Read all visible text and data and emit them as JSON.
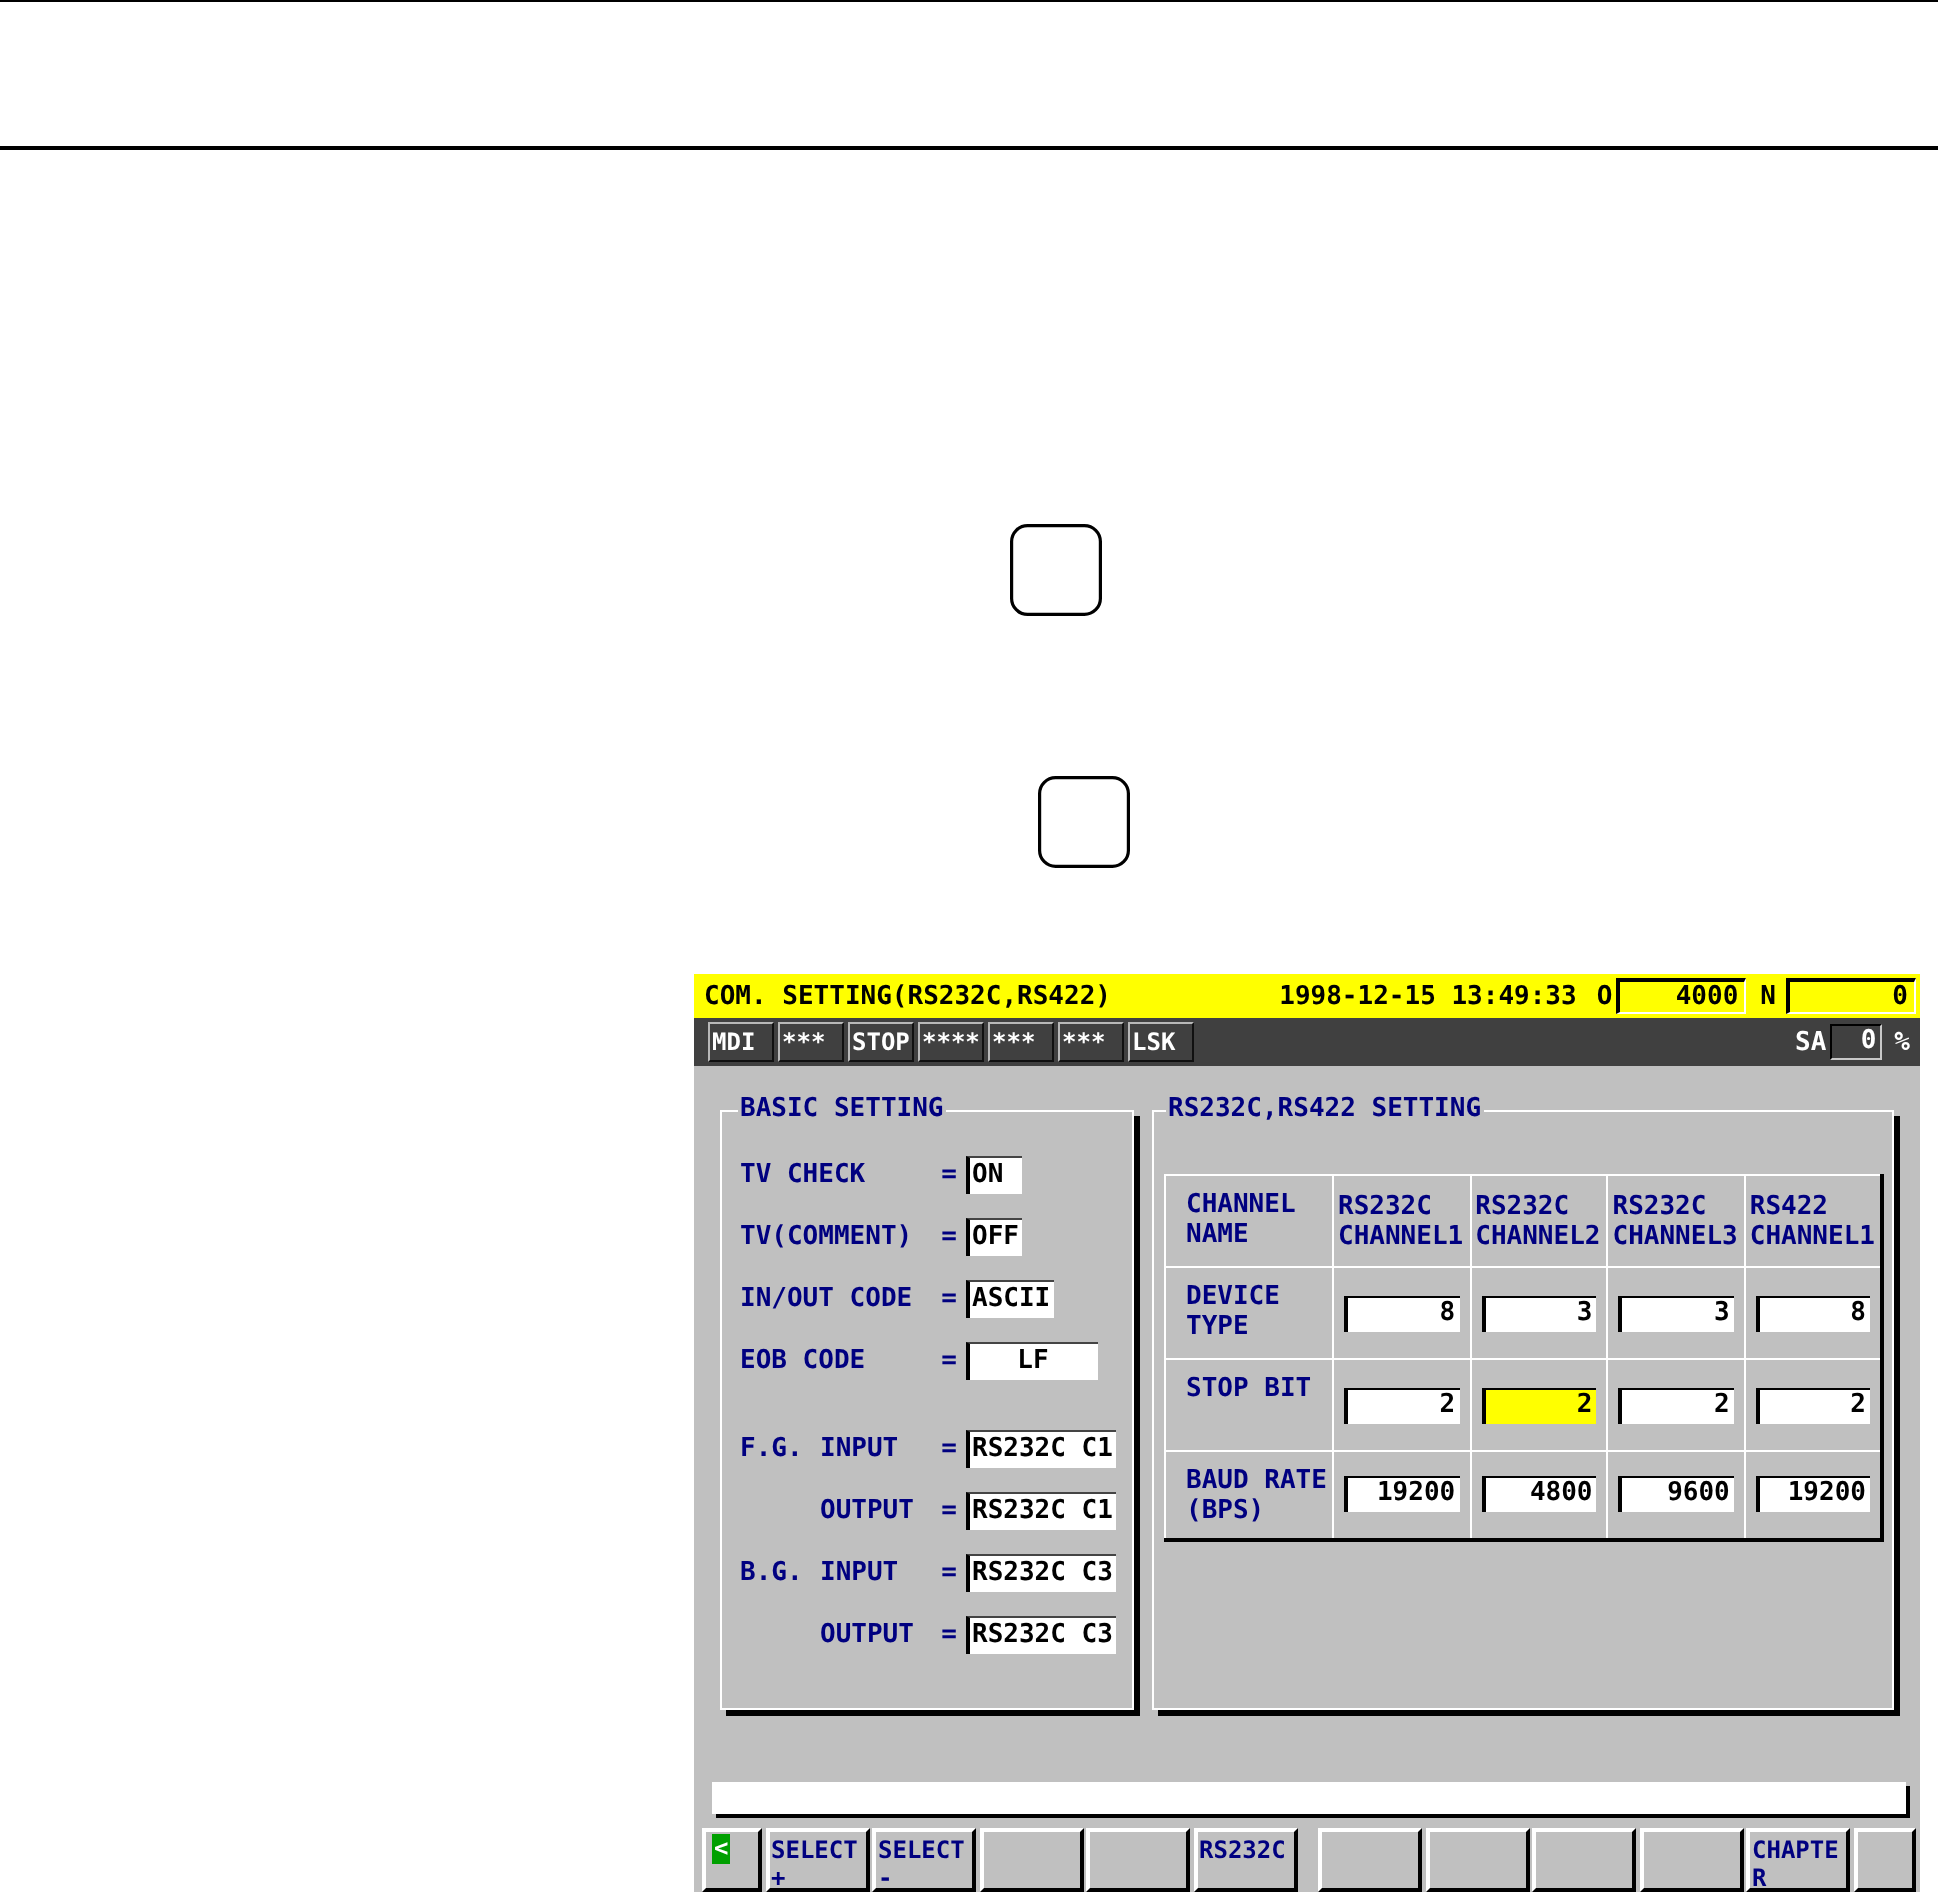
{
  "screen": {
    "title_bar": {
      "title": "COM. SETTING(RS232C,RS422)",
      "datetime": "1998-12-15 13:49:33",
      "o_label": "O",
      "o_value": "4000",
      "n_label": "N",
      "n_value": "0"
    },
    "status_bar": {
      "modes": [
        "MDI",
        "***",
        "STOP",
        "****",
        "***",
        "***",
        "LSK"
      ],
      "sa_label": "SA",
      "sa_value": "0",
      "sa_unit": "%"
    },
    "basic_setting": {
      "title": "BASIC SETTING",
      "sections": [
        {
          "rows": [
            {
              "label": "TV CHECK",
              "sep": "=",
              "value": "ON",
              "kind": "field"
            },
            {
              "label": "TV(COMMENT)",
              "sep": "=",
              "value": "OFF",
              "kind": "field"
            },
            {
              "label": "IN/OUT CODE",
              "sep": "=",
              "value": "ASCII",
              "kind": "field"
            },
            {
              "label": "EOB CODE",
              "sep": "=",
              "value": "LF",
              "kind": "centered"
            }
          ]
        },
        {
          "rows": [
            {
              "label": "F.G.",
              "children": [
                {
                  "label": "INPUT",
                  "sep": "=",
                  "value": "RS232C C1",
                  "kind": "field"
                },
                {
                  "label": "OUTPUT",
                  "sep": "=",
                  "value": "RS232C C1",
                  "kind": "field"
                }
              ]
            },
            {
              "label": "B.G.",
              "children": [
                {
                  "label": "INPUT",
                  "sep": "=",
                  "value": "RS232C C3",
                  "kind": "field"
                },
                {
                  "label": "OUTPUT",
                  "sep": "=",
                  "value": "RS232C C3",
                  "kind": "field"
                }
              ]
            }
          ]
        }
      ]
    },
    "rs_setting": {
      "title": "RS232C,RS422 SETTING",
      "corner": "CHANNEL NAME",
      "columns": [
        "RS232C CHANNEL1",
        "RS232C CHANNEL2",
        "RS232C CHANNEL3",
        "RS422 CHANNEL1"
      ],
      "rows": [
        {
          "label": "DEVICE TYPE",
          "values": [
            {
              "value": "8",
              "selected": false
            },
            {
              "value": "3",
              "selected": false
            },
            {
              "value": "3",
              "selected": false
            },
            {
              "value": "8",
              "selected": false
            }
          ]
        },
        {
          "label": "STOP BIT",
          "values": [
            {
              "value": "2",
              "selected": false
            },
            {
              "value": "2",
              "selected": true
            },
            {
              "value": "2",
              "selected": false
            },
            {
              "value": "2",
              "selected": false
            }
          ]
        },
        {
          "label": "BAUD RATE (BPS)",
          "values": [
            {
              "value": "19200",
              "selected": false
            },
            {
              "value": "4800",
              "selected": false
            },
            {
              "value": "9600",
              "selected": false
            },
            {
              "value": "19200",
              "selected": false
            }
          ]
        }
      ]
    },
    "softkey_groups": [
      {
        "keys": [
          {
            "kind": "back",
            "label": "<"
          },
          {
            "kind": "key",
            "lines": [
              "SELECT",
              "+"
            ]
          },
          {
            "kind": "key",
            "lines": [
              "SELECT",
              "-"
            ]
          },
          {
            "kind": "blank"
          },
          {
            "kind": "blank"
          },
          {
            "kind": "key",
            "lines": [
              "RS232C"
            ]
          }
        ]
      },
      {
        "keys": [
          {
            "kind": "blank"
          },
          {
            "kind": "blank"
          },
          {
            "kind": "blank"
          },
          {
            "kind": "blank"
          },
          {
            "kind": "key",
            "lines": [
              "CHAPTE",
              "R"
            ]
          },
          {
            "kind": "next"
          }
        ]
      }
    ]
  }
}
